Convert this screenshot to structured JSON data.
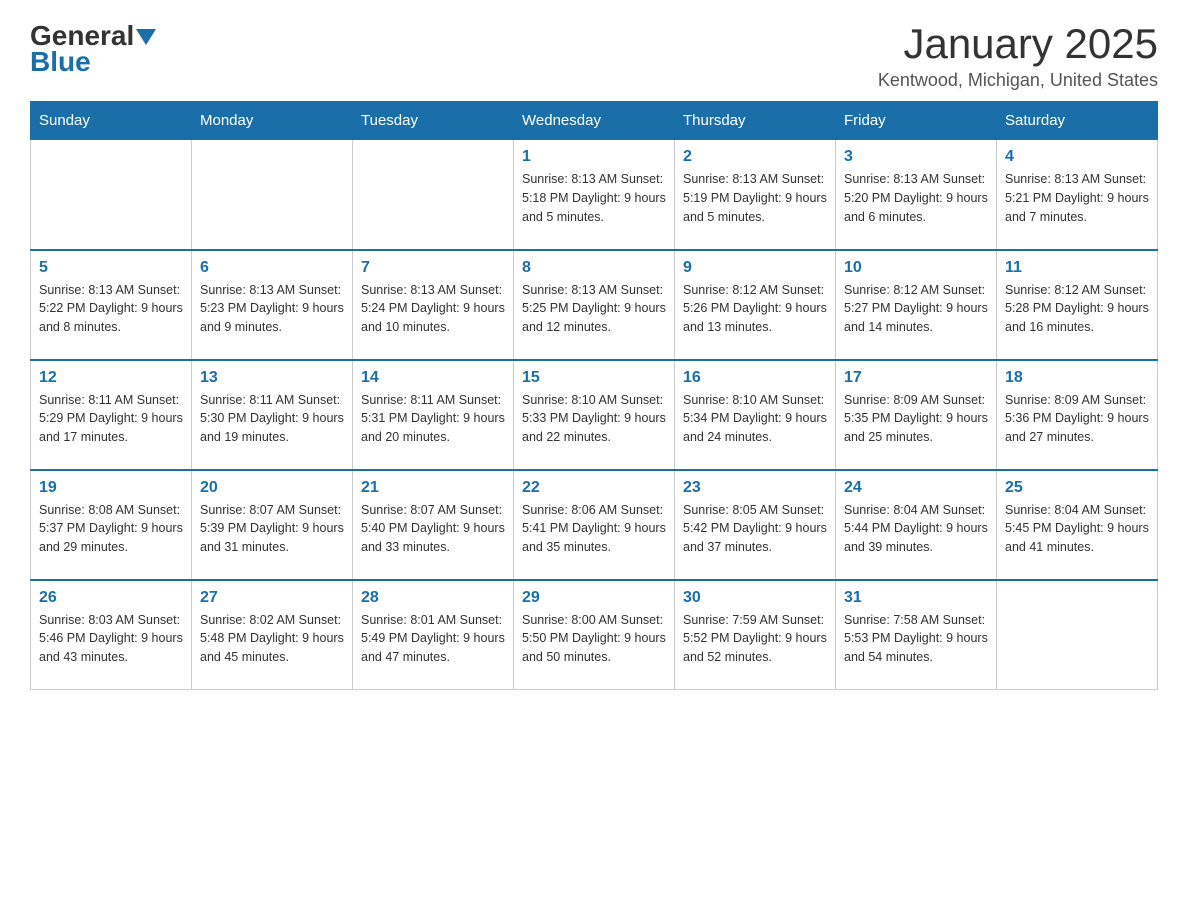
{
  "header": {
    "logo": {
      "general": "General",
      "blue": "Blue"
    },
    "title": "January 2025",
    "location": "Kentwood, Michigan, United States"
  },
  "days_of_week": [
    "Sunday",
    "Monday",
    "Tuesday",
    "Wednesday",
    "Thursday",
    "Friday",
    "Saturday"
  ],
  "weeks": [
    {
      "days": [
        {
          "number": "",
          "info": ""
        },
        {
          "number": "",
          "info": ""
        },
        {
          "number": "",
          "info": ""
        },
        {
          "number": "1",
          "info": "Sunrise: 8:13 AM\nSunset: 5:18 PM\nDaylight: 9 hours and 5 minutes."
        },
        {
          "number": "2",
          "info": "Sunrise: 8:13 AM\nSunset: 5:19 PM\nDaylight: 9 hours and 5 minutes."
        },
        {
          "number": "3",
          "info": "Sunrise: 8:13 AM\nSunset: 5:20 PM\nDaylight: 9 hours and 6 minutes."
        },
        {
          "number": "4",
          "info": "Sunrise: 8:13 AM\nSunset: 5:21 PM\nDaylight: 9 hours and 7 minutes."
        }
      ]
    },
    {
      "days": [
        {
          "number": "5",
          "info": "Sunrise: 8:13 AM\nSunset: 5:22 PM\nDaylight: 9 hours and 8 minutes."
        },
        {
          "number": "6",
          "info": "Sunrise: 8:13 AM\nSunset: 5:23 PM\nDaylight: 9 hours and 9 minutes."
        },
        {
          "number": "7",
          "info": "Sunrise: 8:13 AM\nSunset: 5:24 PM\nDaylight: 9 hours and 10 minutes."
        },
        {
          "number": "8",
          "info": "Sunrise: 8:13 AM\nSunset: 5:25 PM\nDaylight: 9 hours and 12 minutes."
        },
        {
          "number": "9",
          "info": "Sunrise: 8:12 AM\nSunset: 5:26 PM\nDaylight: 9 hours and 13 minutes."
        },
        {
          "number": "10",
          "info": "Sunrise: 8:12 AM\nSunset: 5:27 PM\nDaylight: 9 hours and 14 minutes."
        },
        {
          "number": "11",
          "info": "Sunrise: 8:12 AM\nSunset: 5:28 PM\nDaylight: 9 hours and 16 minutes."
        }
      ]
    },
    {
      "days": [
        {
          "number": "12",
          "info": "Sunrise: 8:11 AM\nSunset: 5:29 PM\nDaylight: 9 hours and 17 minutes."
        },
        {
          "number": "13",
          "info": "Sunrise: 8:11 AM\nSunset: 5:30 PM\nDaylight: 9 hours and 19 minutes."
        },
        {
          "number": "14",
          "info": "Sunrise: 8:11 AM\nSunset: 5:31 PM\nDaylight: 9 hours and 20 minutes."
        },
        {
          "number": "15",
          "info": "Sunrise: 8:10 AM\nSunset: 5:33 PM\nDaylight: 9 hours and 22 minutes."
        },
        {
          "number": "16",
          "info": "Sunrise: 8:10 AM\nSunset: 5:34 PM\nDaylight: 9 hours and 24 minutes."
        },
        {
          "number": "17",
          "info": "Sunrise: 8:09 AM\nSunset: 5:35 PM\nDaylight: 9 hours and 25 minutes."
        },
        {
          "number": "18",
          "info": "Sunrise: 8:09 AM\nSunset: 5:36 PM\nDaylight: 9 hours and 27 minutes."
        }
      ]
    },
    {
      "days": [
        {
          "number": "19",
          "info": "Sunrise: 8:08 AM\nSunset: 5:37 PM\nDaylight: 9 hours and 29 minutes."
        },
        {
          "number": "20",
          "info": "Sunrise: 8:07 AM\nSunset: 5:39 PM\nDaylight: 9 hours and 31 minutes."
        },
        {
          "number": "21",
          "info": "Sunrise: 8:07 AM\nSunset: 5:40 PM\nDaylight: 9 hours and 33 minutes."
        },
        {
          "number": "22",
          "info": "Sunrise: 8:06 AM\nSunset: 5:41 PM\nDaylight: 9 hours and 35 minutes."
        },
        {
          "number": "23",
          "info": "Sunrise: 8:05 AM\nSunset: 5:42 PM\nDaylight: 9 hours and 37 minutes."
        },
        {
          "number": "24",
          "info": "Sunrise: 8:04 AM\nSunset: 5:44 PM\nDaylight: 9 hours and 39 minutes."
        },
        {
          "number": "25",
          "info": "Sunrise: 8:04 AM\nSunset: 5:45 PM\nDaylight: 9 hours and 41 minutes."
        }
      ]
    },
    {
      "days": [
        {
          "number": "26",
          "info": "Sunrise: 8:03 AM\nSunset: 5:46 PM\nDaylight: 9 hours and 43 minutes."
        },
        {
          "number": "27",
          "info": "Sunrise: 8:02 AM\nSunset: 5:48 PM\nDaylight: 9 hours and 45 minutes."
        },
        {
          "number": "28",
          "info": "Sunrise: 8:01 AM\nSunset: 5:49 PM\nDaylight: 9 hours and 47 minutes."
        },
        {
          "number": "29",
          "info": "Sunrise: 8:00 AM\nSunset: 5:50 PM\nDaylight: 9 hours and 50 minutes."
        },
        {
          "number": "30",
          "info": "Sunrise: 7:59 AM\nSunset: 5:52 PM\nDaylight: 9 hours and 52 minutes."
        },
        {
          "number": "31",
          "info": "Sunrise: 7:58 AM\nSunset: 5:53 PM\nDaylight: 9 hours and 54 minutes."
        },
        {
          "number": "",
          "info": ""
        }
      ]
    }
  ]
}
